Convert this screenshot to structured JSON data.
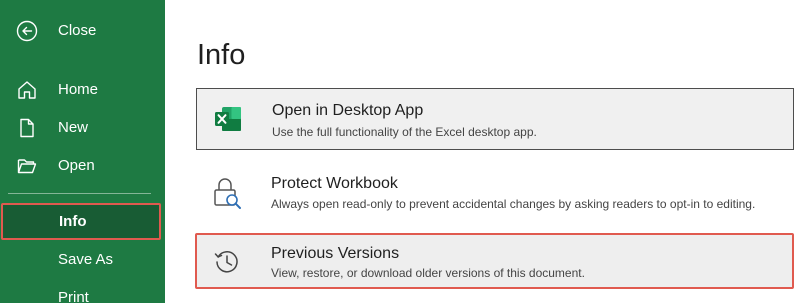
{
  "sidebar": {
    "close_label": "Close",
    "items": [
      {
        "label": "Home",
        "icon": "home-icon"
      },
      {
        "label": "New",
        "icon": "new-document-icon"
      },
      {
        "label": "Open",
        "icon": "folder-icon"
      },
      {
        "label": "Info",
        "selected": true
      },
      {
        "label": "Save As"
      },
      {
        "label": "Print"
      }
    ]
  },
  "main": {
    "title": "Info",
    "cards": [
      {
        "title": "Open in Desktop App",
        "description": "Use the full functionality of the Excel desktop app.",
        "icon": "excel-icon"
      },
      {
        "title": "Protect Workbook",
        "description": "Always open read-only to prevent accidental changes by asking readers to opt-in to editing.",
        "icon": "lock-search-icon"
      },
      {
        "title": "Previous Versions",
        "description": "View, restore, or download older versions of this document.",
        "icon": "history-icon"
      }
    ]
  },
  "colors": {
    "sidebar_bg": "#1e7a43",
    "selected_bg": "#185c34",
    "highlight_border": "#e05a4f",
    "excel_green": "#107c41"
  }
}
